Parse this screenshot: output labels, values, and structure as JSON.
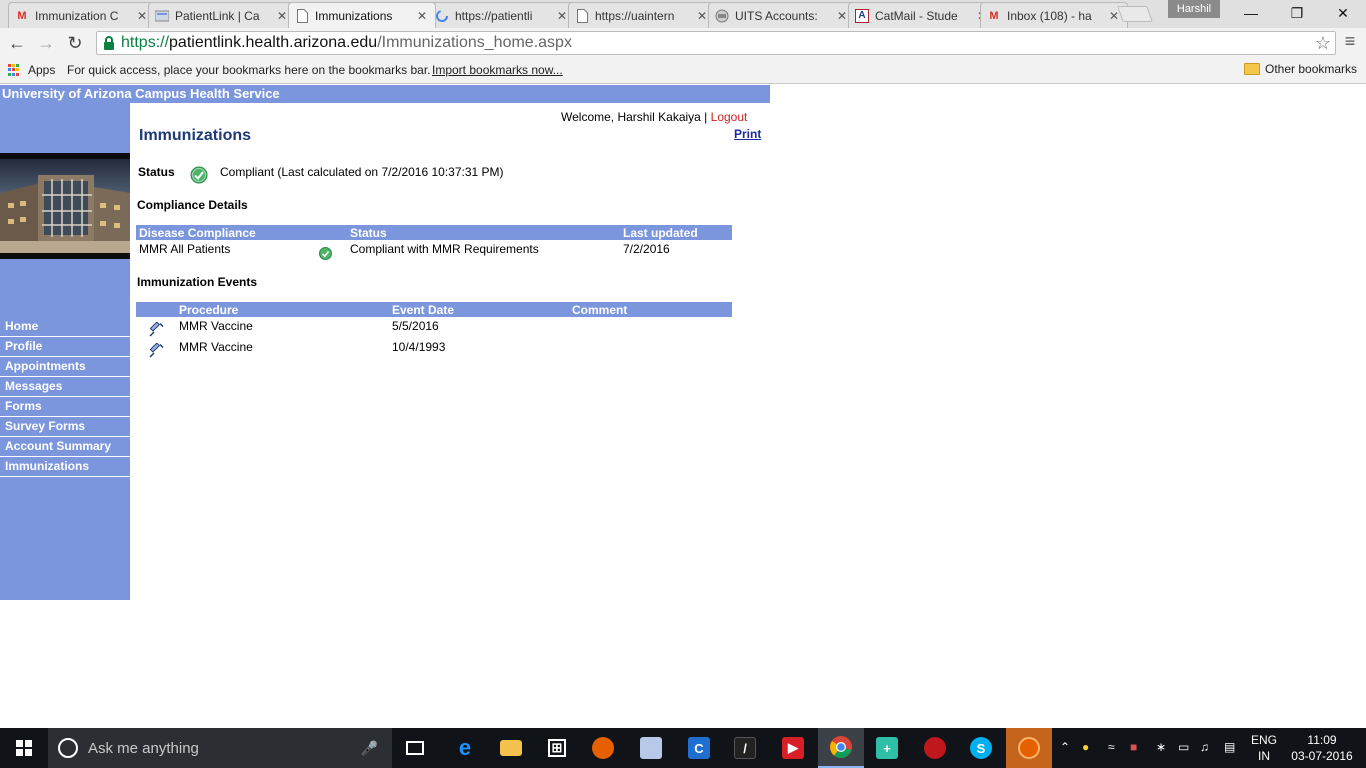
{
  "browser": {
    "tabs": [
      {
        "title": "Immunization C",
        "favicon": "gmail-icon"
      },
      {
        "title": "PatientLink | Ca",
        "favicon": "patientlink-icon"
      },
      {
        "title": "Immunizations",
        "favicon": "page-icon"
      },
      {
        "title": "https://patientli",
        "favicon": "loading-icon"
      },
      {
        "title": "https://uaintern",
        "favicon": "page-icon"
      },
      {
        "title": "UITS Accounts:",
        "favicon": "uits-icon"
      },
      {
        "title": "CatMail - Stude",
        "favicon": "arizona-icon"
      },
      {
        "title": "Inbox (108) - ha",
        "favicon": "gmail-icon"
      }
    ],
    "tab_close_glyph": "✕",
    "profile_name": "Harshil",
    "address": {
      "scheme": "https://",
      "host": "patientlink.health.arizona.edu",
      "path": "/Immunizations_home.aspx"
    },
    "bookmarks": {
      "apps_label": "Apps",
      "hint": "For quick access, place your bookmarks here on the bookmarks bar.",
      "import_label": "Import bookmarks now...",
      "other_label": "Other bookmarks"
    }
  },
  "site": {
    "header": "University of Arizona Campus Health Service",
    "nav": [
      "Home",
      "Profile",
      "Appointments",
      "Messages",
      "Forms",
      "Survey Forms",
      "Account Summary",
      "Immunizations"
    ]
  },
  "page": {
    "welcome": "Welcome, Harshil Kakaiya",
    "separator": "|",
    "logout": "Logout",
    "print": "Print",
    "title": "Immunizations",
    "status_label": "Status",
    "status_value": "Compliant",
    "status_detail": "(Last calculated on 7/2/2016 10:37:31 PM)",
    "compliance": {
      "heading": "Compliance Details",
      "columns": [
        "Disease Compliance",
        "Status",
        "Last updated"
      ],
      "rows": [
        {
          "disease": "MMR All Patients",
          "status": "Compliant with MMR Requirements",
          "updated": "7/2/2016"
        }
      ]
    },
    "events": {
      "heading": "Immunization Events",
      "columns": [
        "Procedure",
        "Event Date",
        "Comment"
      ],
      "rows": [
        {
          "procedure": "MMR Vaccine",
          "date": "5/5/2016",
          "comment": ""
        },
        {
          "procedure": "MMR Vaccine",
          "date": "10/4/1993",
          "comment": ""
        }
      ]
    }
  },
  "taskbar": {
    "search_placeholder": "Ask me anything",
    "language": "ENG",
    "region": "IN",
    "time": "11:09",
    "date": "03-07-2016"
  },
  "colors": {
    "brand_blue": "#7b96dc",
    "title_blue": "#1e3a78",
    "logout_red": "#cc2222",
    "check_green": "#4cb56a"
  }
}
